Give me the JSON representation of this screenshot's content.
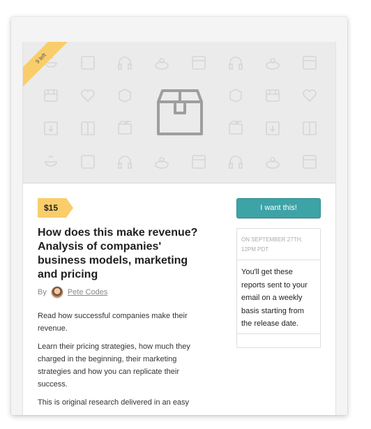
{
  "product": {
    "ribbon": "9 left",
    "price": "$15",
    "title": "How does this make revenue? Analysis of companies' business models, marketing and pricing",
    "by_label": "By",
    "author": "Pete Codes",
    "description": [
      "Read how successful companies make their revenue.",
      "Learn their pricing strategies, how much they charged in the beginning, their marketing strategies and how you can replicate their success.",
      "This is original research delivered in an easy"
    ]
  },
  "sidebar": {
    "cta_label": "I want this!",
    "release_date": "ON SEPTEMBER 27TH, 12PM PDT",
    "info_text": "You'll get these reports sent to your email on a weekly basis starting from the release date."
  },
  "icons": {
    "cover": "package-box-icon",
    "pattern": [
      "bowl-icon",
      "square-icon",
      "headphones-icon",
      "disc-icon",
      "heart-icon",
      "cube-icon",
      "calendar-icon",
      "film-icon",
      "book-icon",
      "tray-icon"
    ]
  },
  "colors": {
    "accent": "#3da3a6",
    "price_tag": "#f9cd6a"
  }
}
